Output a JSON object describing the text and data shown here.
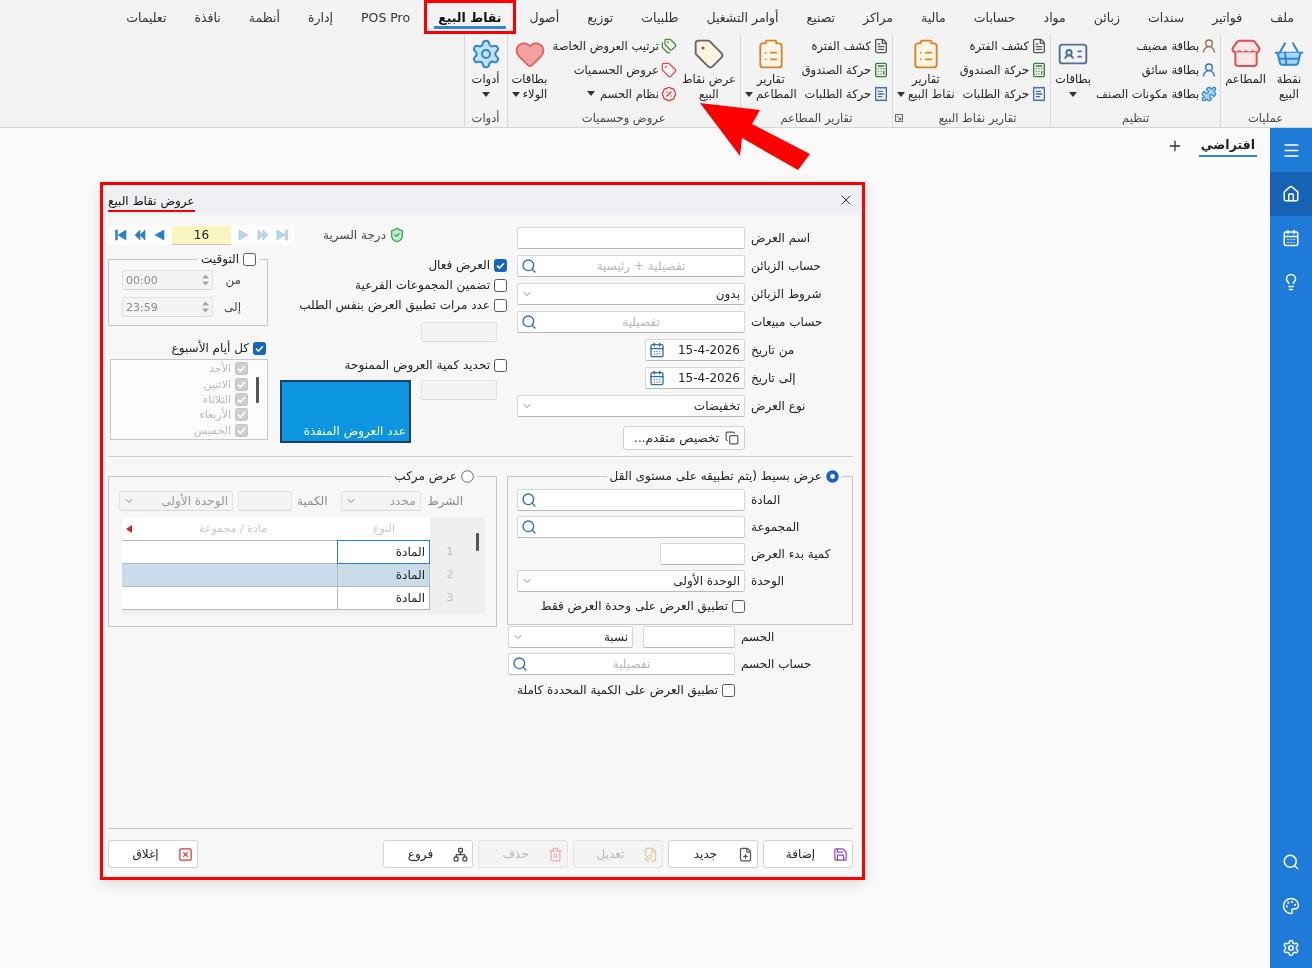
{
  "menu_tabs": [
    {
      "label": "ملف",
      "selected": false,
      "highlighted": false
    },
    {
      "label": "فواتير",
      "selected": false,
      "highlighted": false
    },
    {
      "label": "سندات",
      "selected": false,
      "highlighted": false
    },
    {
      "label": "زبائن",
      "selected": false,
      "highlighted": false
    },
    {
      "label": "مواد",
      "selected": false,
      "highlighted": false
    },
    {
      "label": "حسابات",
      "selected": false,
      "highlighted": false
    },
    {
      "label": "مالية",
      "selected": false,
      "highlighted": false
    },
    {
      "label": "مراكز",
      "selected": false,
      "highlighted": false
    },
    {
      "label": "تصنيع",
      "selected": false,
      "highlighted": false
    },
    {
      "label": "أوامر التشغيل",
      "selected": false,
      "highlighted": false
    },
    {
      "label": "طلبيات",
      "selected": false,
      "highlighted": false
    },
    {
      "label": "توزيع",
      "selected": false,
      "highlighted": false
    },
    {
      "label": "أصول",
      "selected": false,
      "highlighted": false
    },
    {
      "label": "نقاط البيع",
      "selected": true,
      "highlighted": true
    },
    {
      "label": "POS Pro",
      "selected": false,
      "highlighted": false
    },
    {
      "label": "إدارة",
      "selected": false,
      "highlighted": false
    },
    {
      "label": "أنظمة",
      "selected": false,
      "highlighted": false
    },
    {
      "label": "نافذة",
      "selected": false,
      "highlighted": false
    },
    {
      "label": "تعليمات",
      "selected": false,
      "highlighted": false
    }
  ],
  "ribbon_groups": [
    {
      "title": "عمليات",
      "launcher": false,
      "items": [
        {
          "kind": "large",
          "label": "نقطة\nالبيع",
          "menu": false
        },
        {
          "kind": "large",
          "label": "المطاعم",
          "menu": false
        }
      ]
    },
    {
      "title": "تنظيم",
      "launcher": false,
      "items": [
        {
          "kind": "stack",
          "entries": [
            {
              "label": "بطاقة مضيف",
              "menu": false
            },
            {
              "label": "بطاقة سائق",
              "menu": false
            },
            {
              "label": "بطاقة مكونات الصنف",
              "menu": false
            }
          ]
        },
        {
          "kind": "split",
          "label": "بطاقات"
        }
      ]
    },
    {
      "title": "تقارير نقاط البيع",
      "launcher": true,
      "items": [
        {
          "kind": "stack",
          "entries": [
            {
              "label": "كشف الفترة",
              "menu": false
            },
            {
              "label": "حركة الصندوق",
              "menu": false
            },
            {
              "label": "حركة الطلبات",
              "menu": false
            }
          ]
        },
        {
          "kind": "large",
          "label": "تقارير\nنقاط البيع",
          "menu": true
        }
      ]
    },
    {
      "title": "تقارير المطاعم",
      "launcher": false,
      "items": [
        {
          "kind": "stack",
          "entries": [
            {
              "label": "كشف الفترة",
              "menu": false
            },
            {
              "label": "حركة الصندوق",
              "menu": false
            },
            {
              "label": "حركة الطلبات",
              "menu": false
            }
          ]
        },
        {
          "kind": "large",
          "label": "تقارير\nالمطاعم",
          "menu": true
        }
      ]
    },
    {
      "title": "عروض وحسميات",
      "launcher": false,
      "items": [
        {
          "kind": "large",
          "label": "عرض نقاط\nالبيع",
          "menu": false
        },
        {
          "kind": "stack",
          "entries": [
            {
              "label": "ترتيب العروض الخاصة",
              "menu": false
            },
            {
              "label": "عروض الحسميات",
              "menu": false
            },
            {
              "label": "نظام الحسم",
              "menu": true
            }
          ]
        },
        {
          "kind": "large",
          "label": "بطاقات\nالولاء",
          "menu": true
        }
      ]
    },
    {
      "title": "أدوات",
      "launcher": false,
      "items": [
        {
          "kind": "split",
          "label": "أدوات"
        }
      ]
    }
  ],
  "annotation_arrow": true,
  "sidebar": {
    "top": [
      {
        "selected": false
      },
      {
        "selected": true
      },
      {
        "selected": false
      },
      {
        "selected": false
      }
    ],
    "bottom": [
      {
        "selected": false
      },
      {
        "selected": false
      },
      {
        "selected": false
      }
    ]
  },
  "workspace_tabs": [
    {
      "label": "افتراضي",
      "selected": true
    }
  ],
  "dialog": {
    "title": "عروض نقاط البيع",
    "highlighted": true,
    "fields": [
      {
        "kind": "text",
        "label": "اسم العرض"
      },
      {
        "kind": "search",
        "label": "حساب الزبائن",
        "placeholder": "تفصيلية + رئيسية"
      },
      {
        "kind": "select",
        "label": "شروط الزبائن",
        "value": "بدون"
      },
      {
        "kind": "search",
        "label": "حساب مبيعات",
        "placeholder": "تفصيلية"
      },
      {
        "kind": "date",
        "label": "من تاريخ",
        "value": "15-4-2026"
      },
      {
        "kind": "date",
        "label": "إلى تاريخ",
        "value": "15-4-2026"
      },
      {
        "kind": "select",
        "label": "نوع العرض",
        "value": "تخفيضات"
      }
    ],
    "advanced_button": "تخصيص متقدم...",
    "secrecy_label": "درجة السرية",
    "navigator": {
      "forward": [
        {
          "disabled": true
        },
        {
          "disabled": true
        },
        {
          "disabled": true
        }
      ],
      "value": "16",
      "back": [
        {
          "disabled": false
        },
        {
          "disabled": false
        },
        {
          "disabled": false
        }
      ]
    },
    "options": [
      {
        "kind": "check",
        "label": "العرض فعال",
        "checked": true
      },
      {
        "kind": "check",
        "label": "تضمين المجموعات الفرعية",
        "checked": false
      },
      {
        "kind": "check_field",
        "label": "عدد مرات تطبيق العرض بنفس الطلب",
        "checked": false
      },
      {
        "kind": "check_counter",
        "label": "تحديد كمية العروض الممنوحة",
        "checked": false
      }
    ],
    "executed_count_label": "عدد العروض المنفذة",
    "timing": {
      "label": "التوقيت",
      "checked": false,
      "from_label": "من",
      "from": "00:00",
      "to_label": "إلى",
      "to": "23:59"
    },
    "weekdays": {
      "label": "كل أيام الأسبوع",
      "checked": true,
      "list_disabled": true,
      "days": [
        {
          "label": "الأحد",
          "checked": true
        },
        {
          "label": "الاثنين",
          "checked": true
        },
        {
          "label": "الثلاثاء",
          "checked": true
        },
        {
          "label": "الأربعاء",
          "checked": true
        },
        {
          "label": "الخميس",
          "checked": true
        }
      ]
    },
    "simple_offer": {
      "label": "عرض بسيط (يتم تطبيقه على مستوى القل",
      "selected": true,
      "fields": [
        {
          "kind": "search",
          "label": "المادة"
        },
        {
          "kind": "search",
          "label": "المجموعة"
        },
        {
          "kind": "short",
          "label": "كمية بدء العرض"
        },
        {
          "kind": "select",
          "label": "الوحدة",
          "value": "الوحدة الأولى"
        }
      ],
      "unit_only": {
        "label": "تطبيق العرض على وحدة العرض فقط",
        "checked": false
      }
    },
    "discount": {
      "label": "الحسم",
      "type": "نسبة"
    },
    "discount_account": {
      "label": "حساب الحسم",
      "placeholder": "تفصيلية"
    },
    "full_quantity": {
      "label": "تطبيق العرض على الكمية المحددة كاملة",
      "checked": false
    },
    "compound_offer": {
      "label": "عرض مركب",
      "selected": false,
      "condition_label": "الشرط",
      "condition": "محدد",
      "quantity_label": "الكمية",
      "unit": "الوحدة الأولى",
      "columns": [
        "النوع",
        "مادة / مجموعة"
      ],
      "rows": [
        {
          "number": "1",
          "type": "المادة",
          "selected": false,
          "focused": true
        },
        {
          "number": "2",
          "type": "المادة",
          "selected": true,
          "focused": false
        },
        {
          "number": "3",
          "type": "المادة",
          "selected": false,
          "focused": false
        }
      ]
    },
    "actions": [
      {
        "label": "إضافة",
        "disabled": false
      },
      {
        "label": "جديد",
        "disabled": false
      },
      {
        "label": "تعديل",
        "disabled": true
      },
      {
        "label": "حذف",
        "disabled": true
      },
      {
        "label": "فروع",
        "disabled": false
      }
    ],
    "close_label": "إغلاق"
  }
}
